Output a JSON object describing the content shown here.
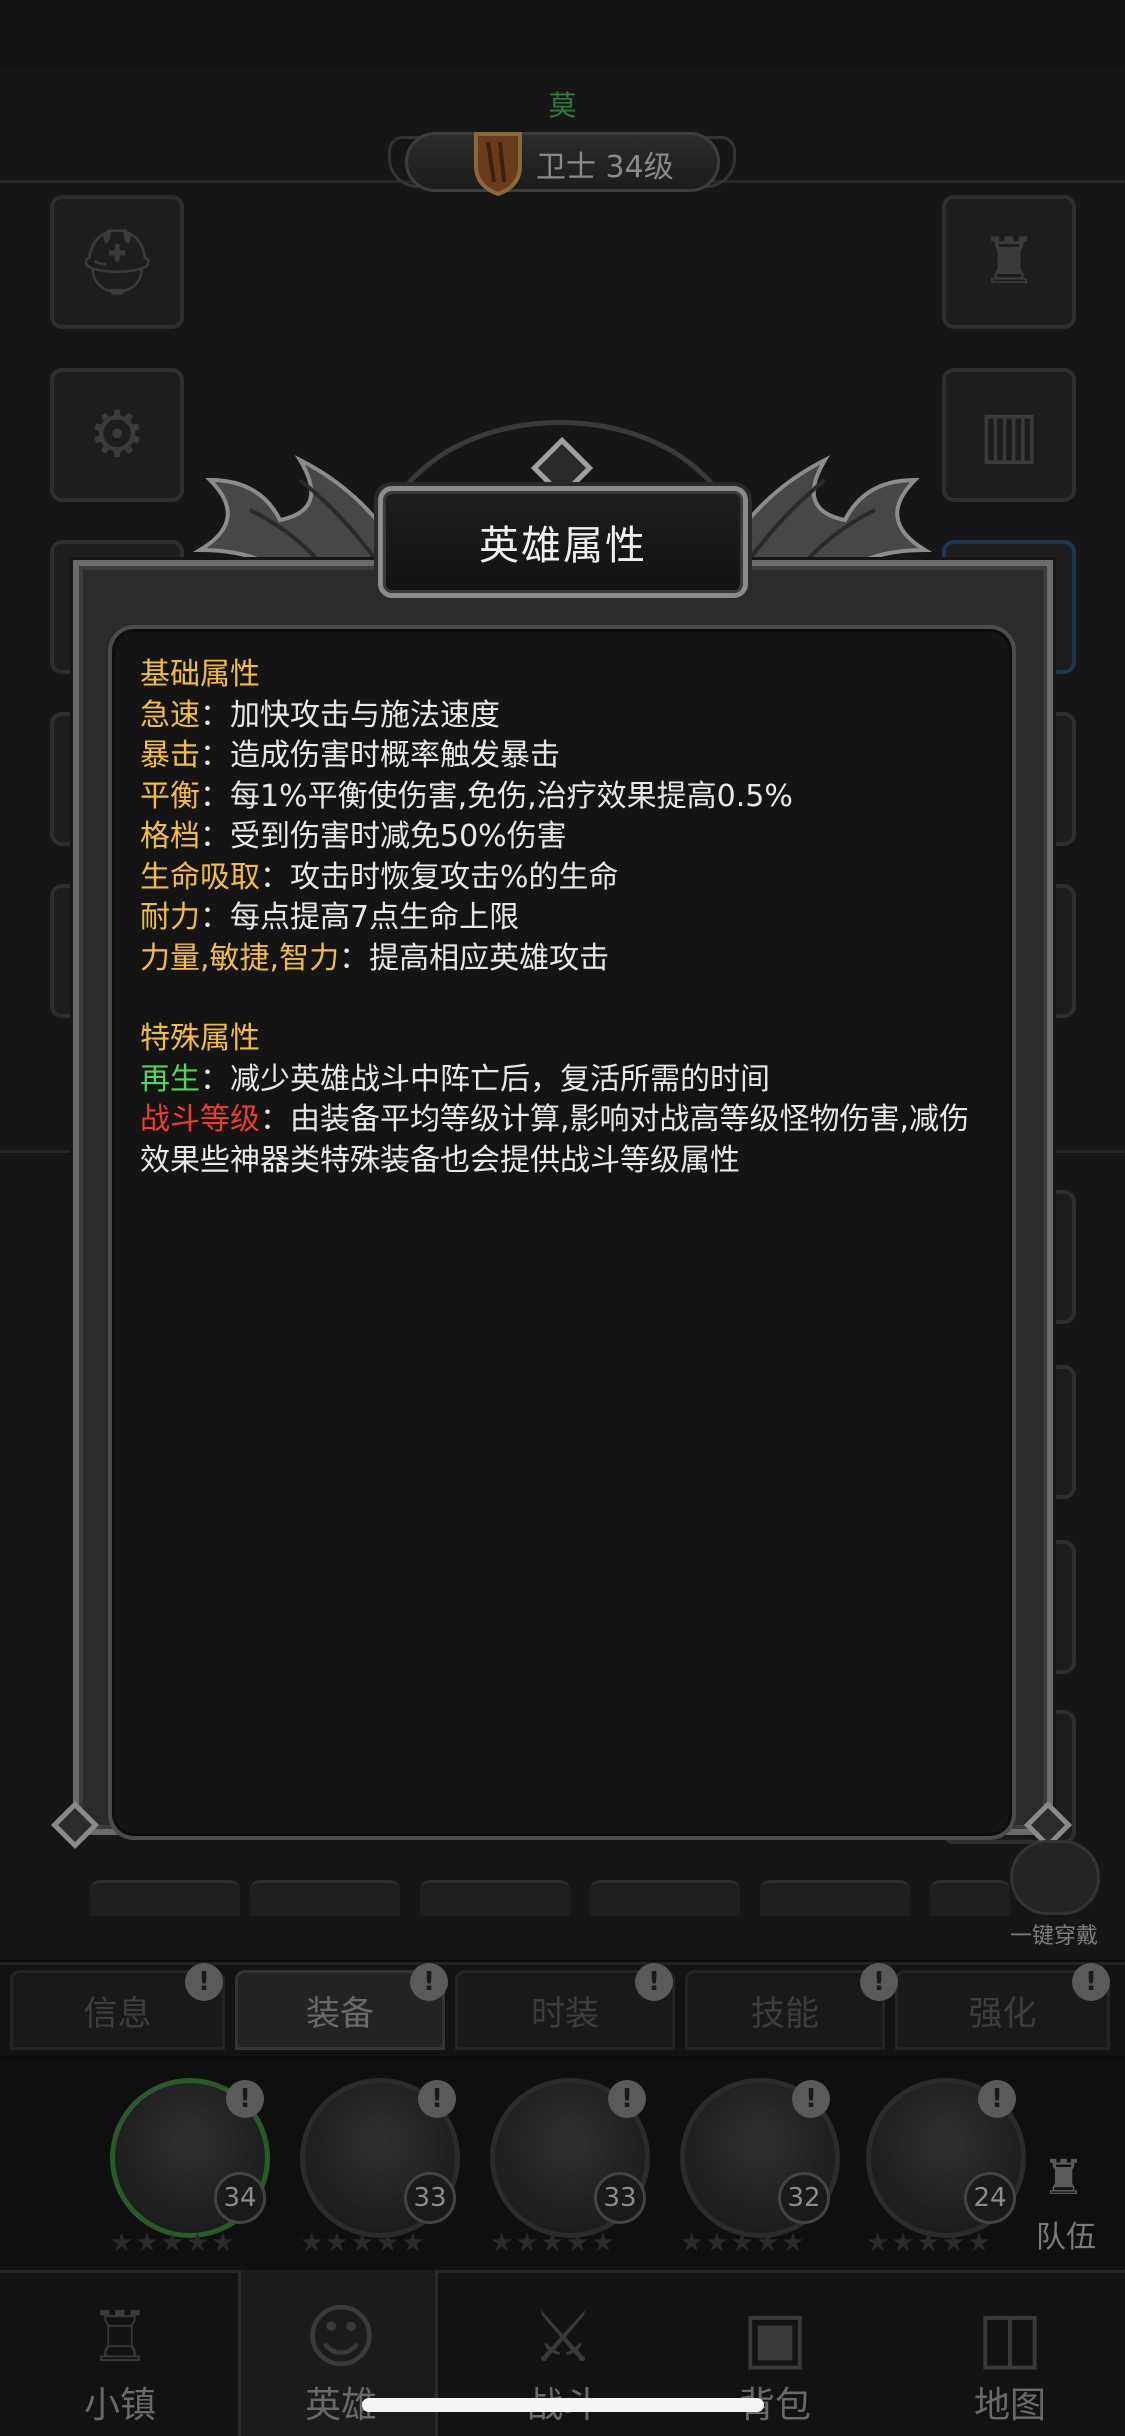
{
  "header": {
    "hero_name": "莫",
    "class_level": "卫士 34级"
  },
  "modal": {
    "title": "英雄属性",
    "basic": {
      "heading": "基础属性",
      "items": [
        {
          "key": "急速",
          "text": "：加快攻击与施法速度"
        },
        {
          "key": "暴击",
          "text": "：造成伤害时概率触发暴击"
        },
        {
          "key": "平衡",
          "text": "：每1%平衡使伤害,免伤,治疗效果提高0.5%"
        },
        {
          "key": "格档",
          "text": "：受到伤害时减免50%伤害"
        },
        {
          "key": "生命吸取",
          "text": "：攻击时恢复攻击%的生命"
        },
        {
          "key": "耐力",
          "text": "：每点提高7点生命上限"
        },
        {
          "key": "力量,敏捷,智力",
          "text": "：提高相应英雄攻击"
        }
      ]
    },
    "special": {
      "heading": "特殊属性",
      "items": [
        {
          "key": "再生",
          "text": "：减少英雄战斗中阵亡后，复活所需的时间"
        },
        {
          "key": "战斗等级",
          "text": "：由装备平均等级计算,影响对战高等级怪物伤害,减伤效果些神器类特殊装备也会提供战斗等级属性"
        }
      ]
    }
  },
  "one_key_equip": "一键穿戴",
  "tabs": [
    "信息",
    "装备",
    "时装",
    "技能",
    "强化"
  ],
  "heroes": [
    {
      "level": "34"
    },
    {
      "level": "33"
    },
    {
      "level": "33"
    },
    {
      "level": "32"
    },
    {
      "level": "24"
    }
  ],
  "team_label": "队伍",
  "nav": [
    "小镇",
    "英雄",
    "战斗",
    "背包",
    "地图"
  ],
  "colors": {
    "key_yellow": "#f3be3d",
    "regen_green": "#57d25a",
    "combat_red": "#f23a2e"
  }
}
